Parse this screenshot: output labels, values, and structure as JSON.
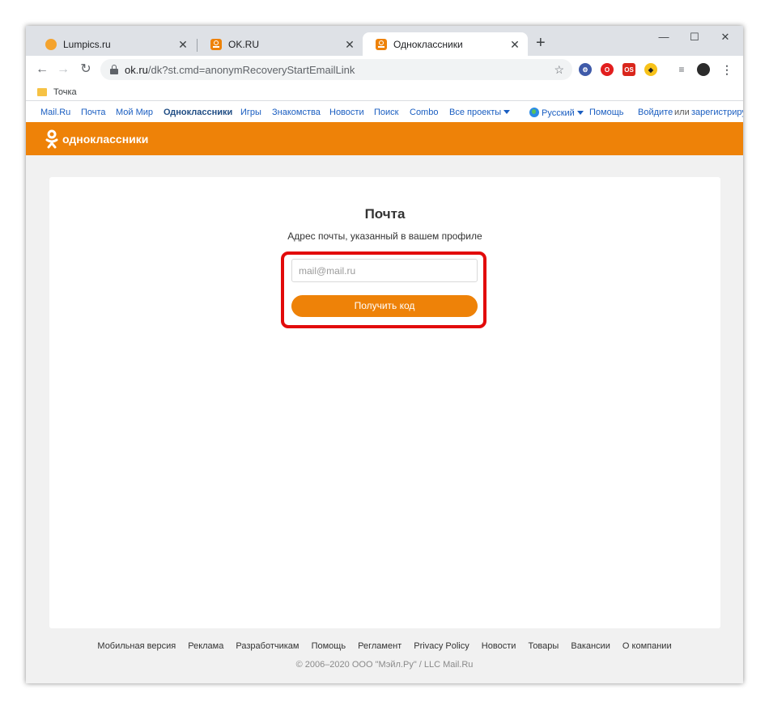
{
  "browser": {
    "tabs": [
      {
        "title": "Lumpics.ru",
        "icon": "lumpics-favicon-icon",
        "active": false
      },
      {
        "title": "OK.RU",
        "icon": "ok-favicon-icon",
        "active": false
      },
      {
        "title": "Одноклассники",
        "icon": "ok-favicon-icon",
        "active": true
      }
    ],
    "new_tab": "+",
    "window_controls": {
      "minimize": "—",
      "maximize": "☐",
      "close": "✕"
    },
    "url_host": "ok.ru",
    "url_path": "/dk?st.cmd=anonymRecoveryStartEmailLink",
    "bookmarks": [
      {
        "label": "Точка",
        "icon": "folder-icon"
      }
    ]
  },
  "site_nav": {
    "links": [
      "Mail.Ru",
      "Почта",
      "Мой Мир",
      "Одноклассники",
      "Игры",
      "Знакомства",
      "Новости",
      "Поиск",
      "Combo",
      "Все проекты"
    ],
    "language": "Русский",
    "help": "Помощь",
    "login": "Войдите",
    "or": "или",
    "register": "зарегистриру"
  },
  "header": {
    "brand": "одноклассники",
    "color": "#ee8208"
  },
  "form": {
    "title": "Почта",
    "subtitle": "Адрес почты, указанный в вашем профиле",
    "email_placeholder": "mail@mail.ru",
    "submit_label": "Получить код"
  },
  "footer": {
    "links": [
      "Мобильная версия",
      "Реклама",
      "Разработчикам",
      "Помощь",
      "Регламент",
      "Privacy Policy",
      "Новости",
      "Товары",
      "Вакансии",
      "О компании"
    ],
    "copyright": "© 2006–2020 ООО \"Мэйл.Ру\" / LLC Mail.Ru"
  }
}
